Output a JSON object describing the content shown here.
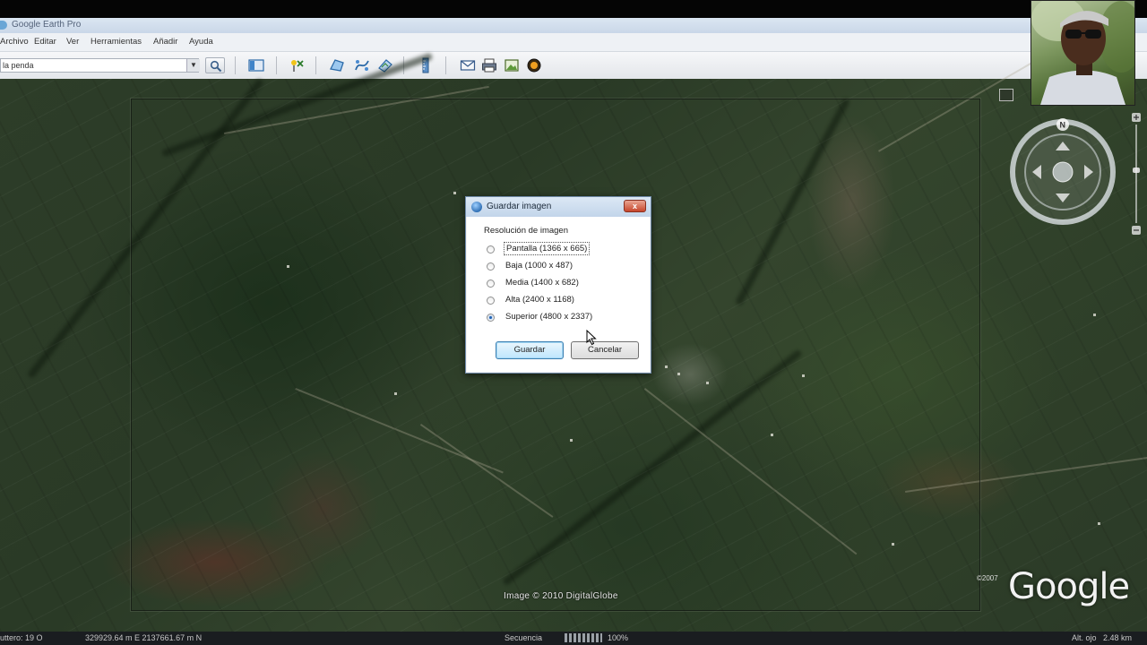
{
  "window": {
    "title": "Google Earth Pro"
  },
  "menu": [
    "Archivo",
    "Editar",
    "Ver",
    "Herramientas",
    "Añadir",
    "Ayuda"
  ],
  "search": {
    "value": "la penda"
  },
  "toolbar": {
    "icons": [
      "sidebar-icon",
      "placemark-icon",
      "polygon-icon",
      "path-icon",
      "image-overlay-icon",
      "ruler-icon",
      "email-icon",
      "print-icon",
      "save-image-icon",
      "sky-icon"
    ]
  },
  "map": {
    "imagery_credit": "Image © 2010 DigitalGlobe",
    "copyright_year": "©2007",
    "logo": "Google",
    "compass_north": "N"
  },
  "status": {
    "left": "uttero: 19 O",
    "coords": "329929.64 m E 2137661.67 m N",
    "streaming_label": "Secuencia",
    "streaming_percent": "100%",
    "altitude": "Alt. ojo   2.48 km"
  },
  "dialog": {
    "title": "Guardar imagen",
    "close_label": "x",
    "group_label": "Resolución de imagen",
    "options": [
      {
        "label": "Pantalla (1366 x 665)",
        "checked": false
      },
      {
        "label": "Baja (1000 x 487)",
        "checked": false
      },
      {
        "label": "Media (1400 x 682)",
        "checked": false
      },
      {
        "label": "Alta (2400 x 1168)",
        "checked": false
      },
      {
        "label": "Superior (4800 x 2337)",
        "checked": true
      }
    ],
    "save_label": "Guardar",
    "cancel_label": "Cancelar"
  }
}
